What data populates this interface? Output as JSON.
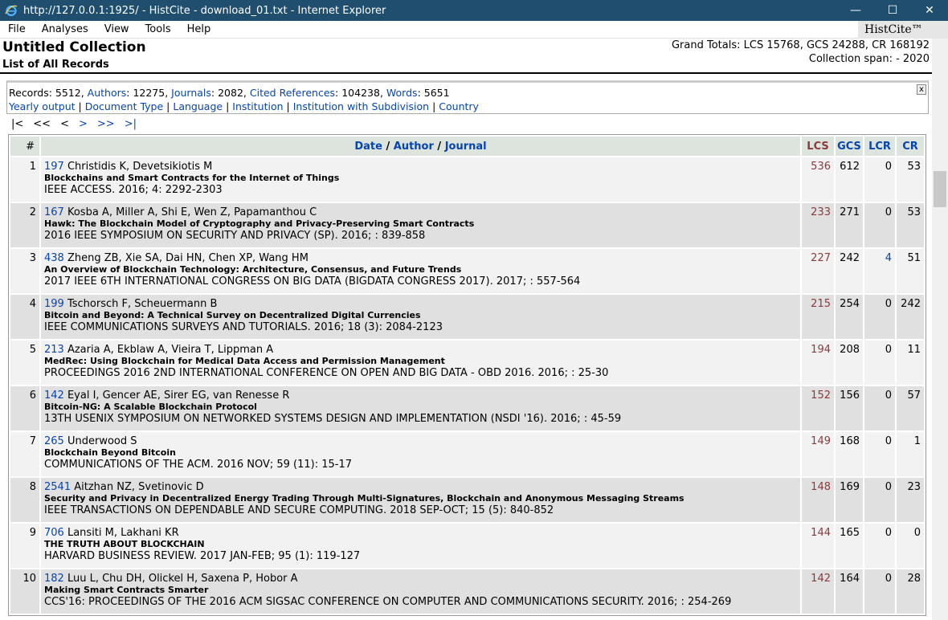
{
  "window": {
    "title": "http://127.0.0.1:1925/ - HistCite - download_01.txt - Internet Explorer"
  },
  "menu": {
    "items": [
      "File",
      "Analyses",
      "View",
      "Tools",
      "Help"
    ],
    "brand": "HistCite™"
  },
  "header": {
    "collection_title": "Untitled Collection",
    "subtitle": "List of All Records",
    "grand_totals": "Grand Totals: LCS 15768, GCS 24288, CR 168192",
    "collection_span": "Collection span: - 2020"
  },
  "info": {
    "records_label": "Records: ",
    "records": "5512",
    "authors_label": "Authors",
    "authors": ": 12275, ",
    "journals_label": "Journals",
    "journals": ": 2082, ",
    "cited_label": "Cited References",
    "cited": ": 104238, ",
    "words_label": "Words",
    "words": ": 5651",
    "links": [
      "Yearly output",
      "Document Type",
      "Language",
      "Institution",
      "Institution with Subdivision",
      "Country"
    ],
    "close": "x"
  },
  "pager": {
    "first": "|<",
    "prev_many": "<<",
    "prev": "<",
    "next": ">",
    "next_many": ">>",
    "last": ">|"
  },
  "table": {
    "headers": {
      "num": "#",
      "date": "Date",
      "author": "Author",
      "journal": "Journal",
      "sep": " / ",
      "lcs": "LCS",
      "gcs": "GCS",
      "lcr": "LCR",
      "cr": "CR"
    },
    "rows": [
      {
        "n": "1",
        "id": "197",
        "authors": "Christidis K, Devetsikiotis M",
        "title": "Blockchains and Smart Contracts for the Internet of Things",
        "source": "IEEE ACCESS. 2016; 4: 2292-2303",
        "lcs": "536",
        "gcs": "612",
        "lcr": "0",
        "cr": "53"
      },
      {
        "n": "2",
        "id": "167",
        "authors": "Kosba A, Miller A, Shi E, Wen Z, Papamanthou C",
        "title": "Hawk: The Blockchain Model of Cryptography and Privacy-Preserving Smart Contracts",
        "source": "2016 IEEE SYMPOSIUM ON SECURITY AND PRIVACY (SP). 2016; : 839-858",
        "lcs": "233",
        "gcs": "271",
        "lcr": "0",
        "cr": "53"
      },
      {
        "n": "3",
        "id": "438",
        "authors": "Zheng ZB, Xie SA, Dai HN, Chen XP, Wang HM",
        "title": "An Overview of Blockchain Technology: Architecture, Consensus, and Future Trends",
        "source": "2017 IEEE 6TH INTERNATIONAL CONGRESS ON BIG DATA (BIGDATA CONGRESS 2017). 2017; : 557-564",
        "lcs": "227",
        "gcs": "242",
        "lcr": "4",
        "cr": "51"
      },
      {
        "n": "4",
        "id": "199",
        "authors": "Tschorsch F, Scheuermann B",
        "title": "Bitcoin and Beyond: A Technical Survey on Decentralized Digital Currencies",
        "source": "IEEE COMMUNICATIONS SURVEYS AND TUTORIALS. 2016; 18 (3): 2084-2123",
        "lcs": "215",
        "gcs": "254",
        "lcr": "0",
        "cr": "242"
      },
      {
        "n": "5",
        "id": "213",
        "authors": "Azaria A, Ekblaw A, Vieira T, Lippman A",
        "title": "MedRec: Using Blockchain for Medical Data Access and Permission Management",
        "source": "PROCEEDINGS 2016 2ND INTERNATIONAL CONFERENCE ON OPEN AND BIG DATA - OBD 2016. 2016; : 25-30",
        "lcs": "194",
        "gcs": "208",
        "lcr": "0",
        "cr": "11"
      },
      {
        "n": "6",
        "id": "142",
        "authors": "Eyal I, Gencer AE, Sirer EG, van Renesse R",
        "title": "Bitcoin-NG: A Scalable Blockchain Protocol",
        "source": "13TH USENIX SYMPOSIUM ON NETWORKED SYSTEMS DESIGN AND IMPLEMENTATION (NSDI '16). 2016; : 45-59",
        "lcs": "152",
        "gcs": "156",
        "lcr": "0",
        "cr": "57"
      },
      {
        "n": "7",
        "id": "265",
        "authors": "Underwood S",
        "title": "Blockchain Beyond Bitcoin",
        "source": "COMMUNICATIONS OF THE ACM. 2016 NOV; 59 (11): 15-17",
        "lcs": "149",
        "gcs": "168",
        "lcr": "0",
        "cr": "1"
      },
      {
        "n": "8",
        "id": "2541",
        "authors": "Aitzhan NZ, Svetinovic D",
        "title": "Security and Privacy in Decentralized Energy Trading Through Multi-Signatures, Blockchain and Anonymous Messaging Streams",
        "source": "IEEE TRANSACTIONS ON DEPENDABLE AND SECURE COMPUTING. 2018 SEP-OCT; 15 (5): 840-852",
        "lcs": "148",
        "gcs": "169",
        "lcr": "0",
        "cr": "23"
      },
      {
        "n": "9",
        "id": "706",
        "authors": "Lansiti M, Lakhani KR",
        "title": "THE TRUTH ABOUT BLOCKCHAIN",
        "source": "HARVARD BUSINESS REVIEW. 2017 JAN-FEB; 95 (1): 119-127",
        "lcs": "144",
        "gcs": "165",
        "lcr": "0",
        "cr": "0"
      },
      {
        "n": "10",
        "id": "182",
        "authors": "Luu L, Chu DH, Olickel H, Saxena P, Hobor A",
        "title": "Making Smart Contracts Smarter",
        "source": "CCS'16: PROCEEDINGS OF THE 2016 ACM SIGSAC CONFERENCE ON COMPUTER AND COMMUNICATIONS SECURITY. 2016; : 254-269",
        "lcs": "142",
        "gcs": "164",
        "lcr": "0",
        "cr": "28"
      }
    ]
  }
}
